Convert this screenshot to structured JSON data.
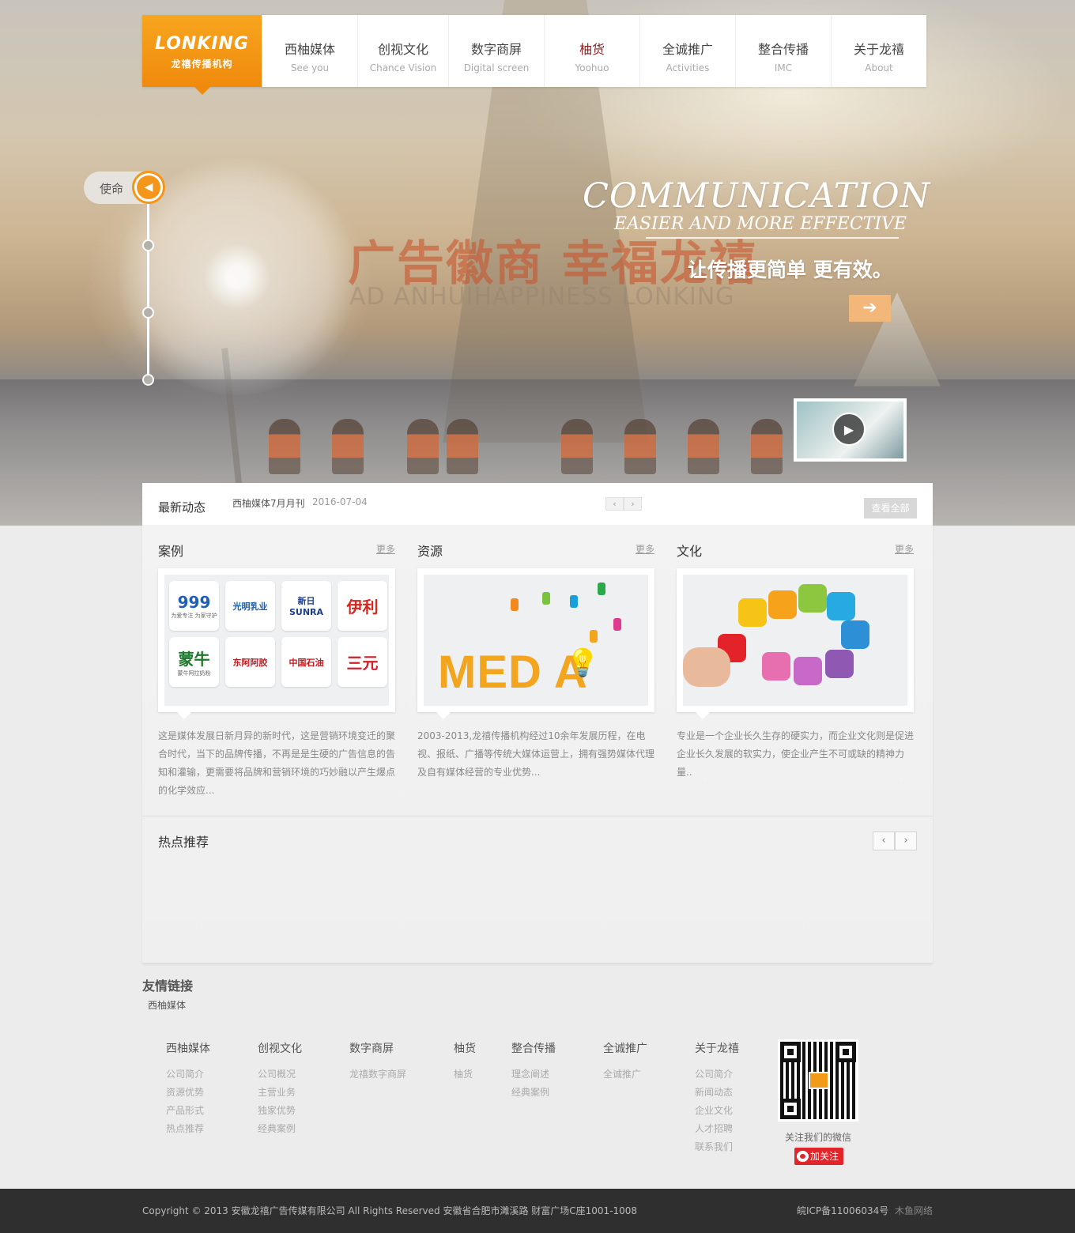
{
  "logo": {
    "brand": "LONKING",
    "subtitle": "龙禧传播机构"
  },
  "nav": [
    {
      "zh": "西柚媒体",
      "en": "See you"
    },
    {
      "zh": "创视文化",
      "en": "Chance Vision"
    },
    {
      "zh": "数字商屏",
      "en": "Digital screen"
    },
    {
      "zh": "柚货",
      "en": "Yoohuo",
      "active": true
    },
    {
      "zh": "全诚推广",
      "en": "Activities"
    },
    {
      "zh": "整合传播",
      "en": "IMC"
    },
    {
      "zh": "关于龙禧",
      "en": "About"
    }
  ],
  "hero": {
    "mission_label": "使命",
    "headline": "COMMUNICATION",
    "headline_sub": "EASIER AND MORE EFFECTIVE",
    "slogan_zh": "广告徽商 幸福龙禧",
    "slogan_en": "AD ANHUIHAPPINESS LONKING",
    "tagline": "让传播更简单 更有效。",
    "go_icon": "arrow-right-icon",
    "play_icon": "play-icon"
  },
  "news": {
    "title": "最新动态",
    "item": "西柚媒体7月月刊",
    "date": "2016-07-04",
    "prev": "‹",
    "next": "›",
    "view_all": "查看全部"
  },
  "sections": [
    {
      "title": "案例",
      "more": "更多",
      "text": "这是媒体发展日新月异的新时代，这是营销环境变迁的聚合时代，当下的品牌传播，不再是是生硬的广告信息的告知和灌输，更需要将品牌和营销环境的巧妙融以产生爆点的化学效应..."
    },
    {
      "title": "资源",
      "more": "更多",
      "text": "2003-2013,龙禧传播机构经过10余年发展历程，在电视、报纸、广播等传统大媒体运营上，拥有强势媒体代理及自有媒体经营的专业优势..."
    },
    {
      "title": "文化",
      "more": "更多",
      "text": "专业是一个企业长久生存的硬实力，而企业文化则是促进企业长久发展的软实力，使企业产生不可或缺的精神力量.."
    }
  ],
  "brands": [
    {
      "line1": "999",
      "line2": "为爱专注 为家守护",
      "color": "#1f5fb5"
    },
    {
      "line1": "光明乳业",
      "line2": "",
      "color": "#1d5fb0"
    },
    {
      "line1": "新日SUNRA",
      "line2": "",
      "color": "#1a3e8f"
    },
    {
      "line1": "伊利",
      "line2": "",
      "color": "#d8261e"
    },
    {
      "line1": "蒙牛",
      "line2": "蒙牛阿拉奶粉",
      "color": "#1c7a2a"
    },
    {
      "line1": "东阿阿胶",
      "line2": "",
      "color": "#b81f25"
    },
    {
      "line1": "中国石油",
      "line2": "",
      "color": "#c8141b"
    },
    {
      "line1": "三元",
      "line2": "",
      "color": "#d0202a"
    }
  ],
  "media_word": "MED   A",
  "hot": {
    "title": "热点推荐",
    "prev": "‹",
    "next": "›"
  },
  "friends": {
    "title": "友情链接",
    "items": [
      "西柚媒体"
    ]
  },
  "footer_nav": [
    {
      "title": "西柚媒体",
      "links": [
        "公司简介",
        "资源优势",
        "产品形式",
        "热点推荐"
      ]
    },
    {
      "title": "创视文化",
      "links": [
        "公司概况",
        "主营业务",
        "独家优势",
        "经典案例"
      ]
    },
    {
      "title": "数字商屏",
      "links": [
        "龙禧数字商屏"
      ]
    },
    {
      "title": "柚货",
      "links": [
        "柚货"
      ]
    },
    {
      "title": "整合传播",
      "links": [
        "理念阐述",
        "经典案例"
      ]
    },
    {
      "title": "全诚推广",
      "links": [
        "全诚推广"
      ]
    },
    {
      "title": "关于龙禧",
      "links": [
        "公司简介",
        "新闻动态",
        "企业文化",
        "人才招聘",
        "联系我们"
      ]
    }
  ],
  "wechat_caption": "关注我们的微信",
  "weibo_follow": "加关注",
  "bottom": {
    "copyright": "Copyright © 2013 安徽龙禧广告传媒有限公司  All Rights Reserved  安徽省合肥市濉溪路  财富广场C座1001-1008",
    "icp": "皖ICP备11006034号",
    "author": "木鱼网络"
  },
  "colors": {
    "accent": "#f3961a",
    "nav_active": "#8b1b1b",
    "footer_bg": "#2f2f2f"
  }
}
